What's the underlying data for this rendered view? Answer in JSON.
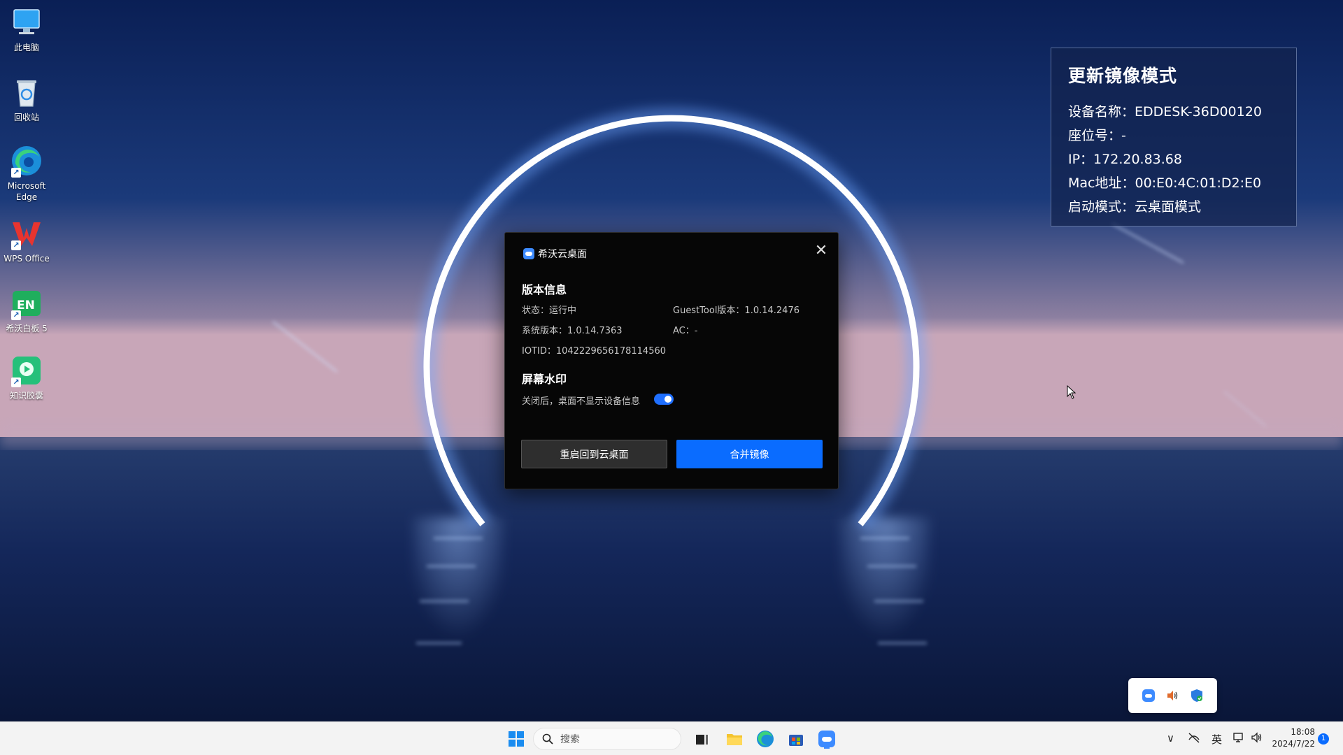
{
  "desktop": {
    "icons": [
      {
        "label": "此电脑",
        "icon": "computer-icon"
      },
      {
        "label": "回收站",
        "icon": "recycle-bin-icon"
      },
      {
        "label": "Microsoft Edge",
        "icon": "edge-icon"
      },
      {
        "label": "WPS Office",
        "icon": "wps-icon"
      },
      {
        "label": "希沃白板 5",
        "icon": "seewo-board-icon"
      },
      {
        "label": "知识胶囊",
        "icon": "knowledge-capsule-icon"
      }
    ]
  },
  "info_panel": {
    "title": "更新镜像模式",
    "rows": [
      "设备名称：EDDESK-36D00120",
      "座位号：-",
      "IP：172.20.83.68",
      "Mac地址：00:E0:4C:01:D2:E0",
      "启动模式：云桌面模式"
    ]
  },
  "dialog": {
    "app_name": "希沃云桌面",
    "close_glyph": "✕",
    "version_section": {
      "title": "版本信息",
      "status": "状态：运行中",
      "guesttool": "GuestTool版本：1.0.14.2476",
      "system_version": "系统版本：1.0.14.7363",
      "ac": "AC：-",
      "iotid": "IOTID：1042229656178114560"
    },
    "watermark_section": {
      "title": "屏幕水印",
      "description": "关闭后，桌面不显示设备信息",
      "toggle_on": true
    },
    "buttons": {
      "restart": "重启回到云桌面",
      "merge": "合并镜像"
    }
  },
  "tray_flyout": {
    "icons": [
      "cloud-desktop-icon",
      "speaker-icon",
      "security-shield-icon"
    ]
  },
  "taskbar": {
    "search_label": "搜索",
    "input_lang": "英",
    "time": "18:08",
    "date": "2024/7/22",
    "notification_count": "1",
    "chevron": "∨"
  },
  "colors": {
    "accent": "#0a6cff",
    "dialog_bg": "#060606",
    "panel_bg": "#12224e",
    "taskbar_bg": "#f3f3f3"
  }
}
